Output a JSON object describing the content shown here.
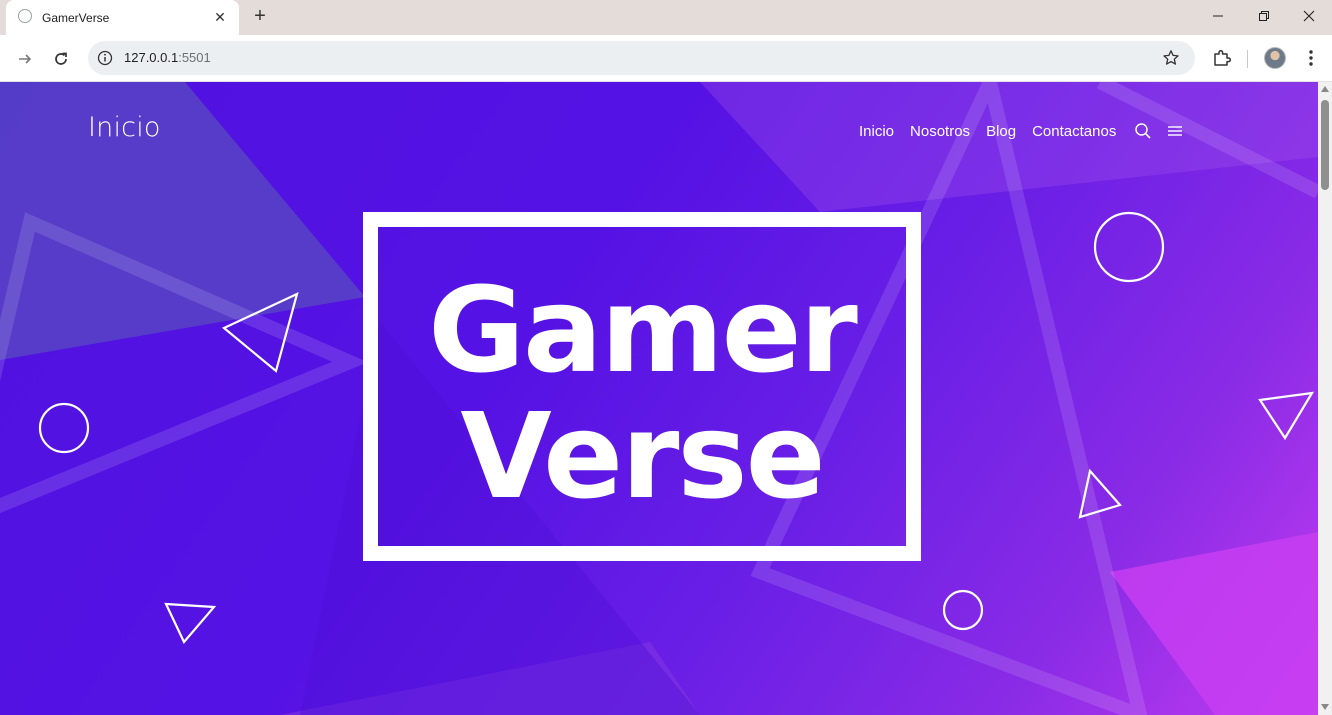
{
  "browser": {
    "tab": {
      "title": "GamerVerse",
      "close_glyph": "✕"
    },
    "new_tab_glyph": "+",
    "window_controls": {
      "minimize": "—",
      "maximize": "❐",
      "close": "✕"
    },
    "address": {
      "host": "127.0.0.1",
      "port": ":5501"
    },
    "icons": [
      "favicon-icon",
      "close-icon",
      "plus-icon",
      "forward-icon",
      "reload-icon",
      "info-icon",
      "star-icon",
      "extensions-icon",
      "avatar",
      "more-icon"
    ]
  },
  "site": {
    "logo": "Inicio",
    "nav": [
      {
        "label": "Inicio"
      },
      {
        "label": "Nosotros"
      },
      {
        "label": "Blog"
      },
      {
        "label": "Contactanos"
      }
    ],
    "tools": [
      "search-icon",
      "menu-icon"
    ]
  },
  "hero": {
    "line1": "Gamer",
    "line2": "Verse"
  },
  "colors": {
    "bg_start": "#4f12e0",
    "bg_mid": "#6a1fe6",
    "bg_end": "#c13cf0",
    "text": "#ffffff"
  }
}
